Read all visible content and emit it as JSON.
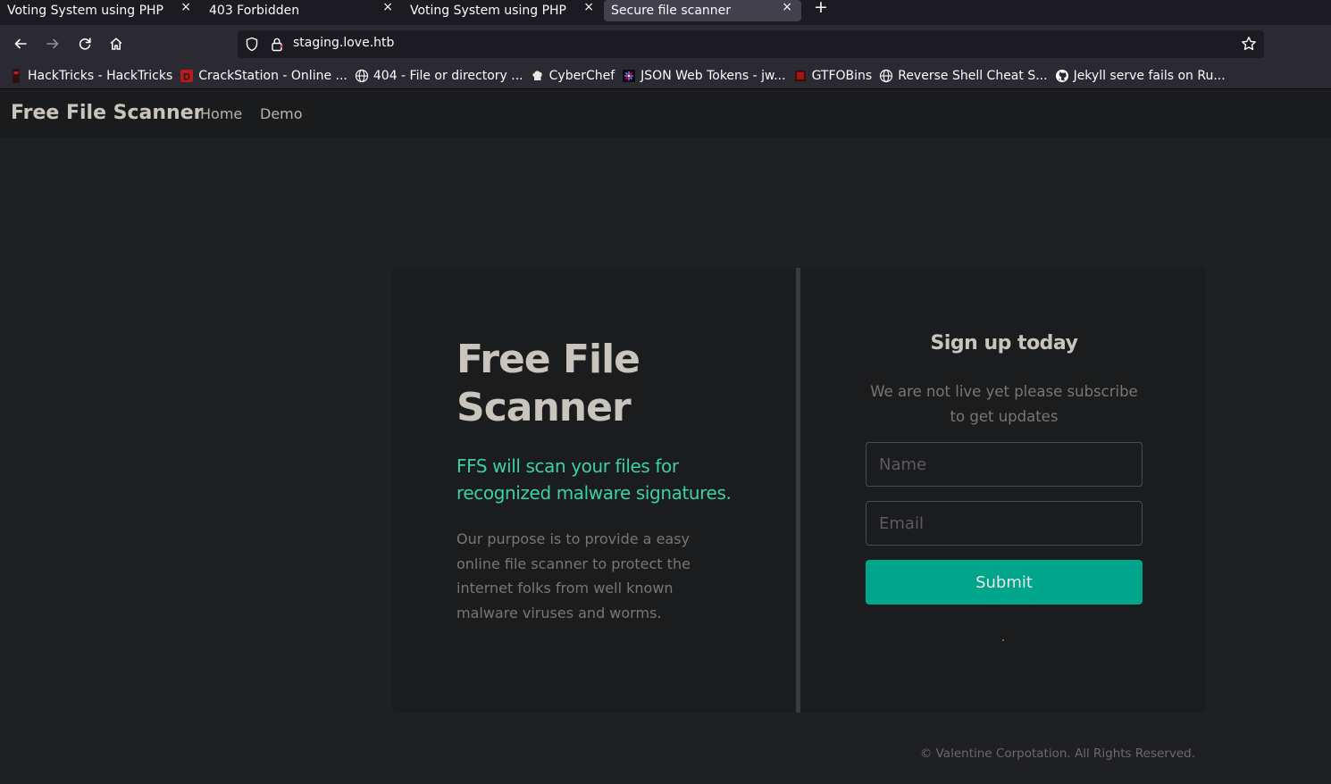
{
  "browser": {
    "tabs": [
      {
        "title": "Voting System using PHP",
        "active": false
      },
      {
        "title": "403 Forbidden",
        "active": false
      },
      {
        "title": "Voting System using PHP",
        "active": false
      },
      {
        "title": "Secure file scanner",
        "active": true
      }
    ],
    "tab_close_glyph": "×",
    "new_tab_glyph": "+",
    "url": "staging.love.htb",
    "bookmarks": [
      {
        "label": "HackTricks - HackTricks",
        "icon": "hacktricks-icon"
      },
      {
        "label": "CrackStation - Online ...",
        "icon": "crackstation-icon"
      },
      {
        "label": "404 - File or directory ...",
        "icon": "globe-icon"
      },
      {
        "label": "CyberChef",
        "icon": "chef-hat-icon"
      },
      {
        "label": "JSON Web Tokens - jw...",
        "icon": "jwt-icon"
      },
      {
        "label": "GTFOBins",
        "icon": "gtfobins-icon"
      },
      {
        "label": "Reverse Shell Cheat S...",
        "icon": "globe-icon"
      },
      {
        "label": "Jekyll serve fails on Ru...",
        "icon": "github-icon"
      }
    ]
  },
  "site": {
    "brand": "Free File Scanner",
    "nav": [
      "Home",
      "Demo"
    ],
    "hero": {
      "title": "Free File Scanner",
      "subtitle": "FFS will scan your files for recognized malware signatures.",
      "body": "Our purpose is to provide a easy online file scanner to protect the internet folks from well known malware viruses and worms."
    },
    "signup": {
      "title": "Sign up today",
      "text": "We are not live yet please subscribe to get updates",
      "name_placeholder": "Name",
      "email_placeholder": "Email",
      "submit_label": "Submit"
    },
    "footer": "© Valentine Corpotation. All Rights Reserved.",
    "colors": {
      "accent": "#3ccfaa",
      "button": "#00a58b"
    }
  }
}
